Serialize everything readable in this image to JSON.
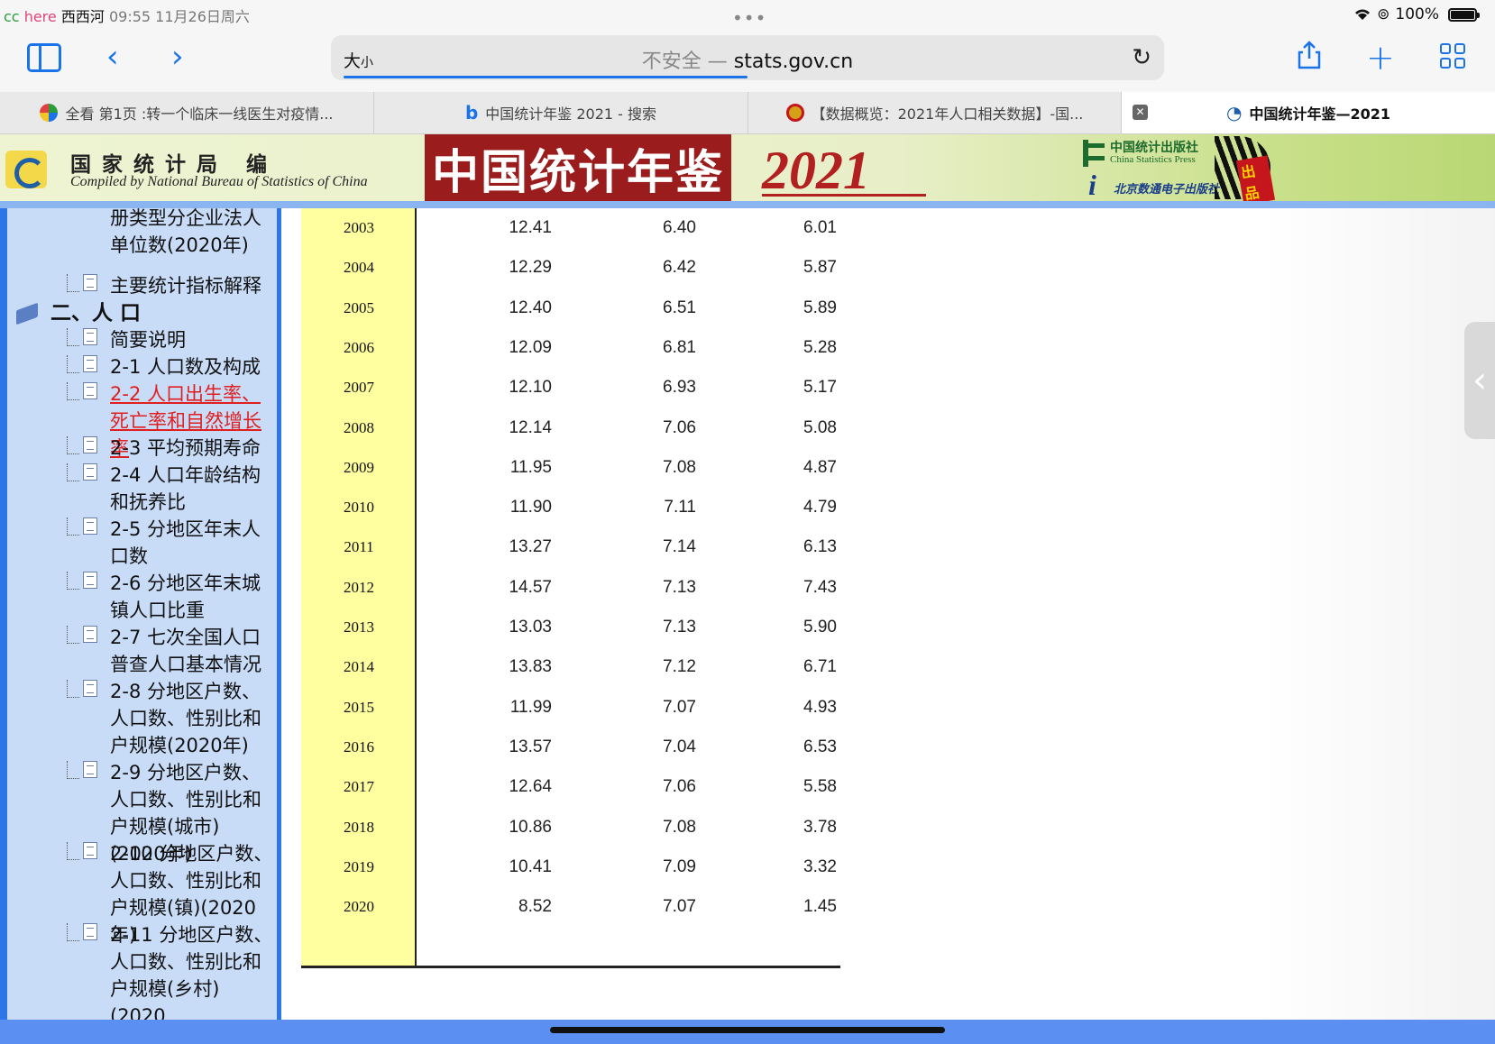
{
  "status": {
    "overlay_cc": "cc",
    "overlay_here": "here",
    "overlay_place": "西西河",
    "time_date": "09:55  11月26日周六",
    "battery": "100%"
  },
  "toolbar": {
    "text_size": "大",
    "text_size_small": "小",
    "insecure": "不安全 —",
    "domain": "stats.gov.cn",
    "load_progress": 0.5
  },
  "tabs": [
    {
      "title": "全看 第1页 :转一个临床一线医生对疫情...",
      "active": false
    },
    {
      "title": "中国统计年鉴 2021 - 搜索",
      "active": false
    },
    {
      "title": "【数据概览：2021年人口相关数据】-国...",
      "active": false
    },
    {
      "title": "中国统计年鉴—2021",
      "active": true
    }
  ],
  "banner": {
    "bureau": "国家统计局  编",
    "compiled": "Compiled by National Bureau of Statistics of China",
    "title": "中国统计年鉴",
    "year": "2021",
    "publisher_cn": "中国统计出版社",
    "publisher_en": "China Statistics Press",
    "publisher2": "北京数通电子出版社",
    "badge": "出品"
  },
  "nav": {
    "items_before": [
      {
        "text": "册类型分企业法人单位数(2020年)",
        "active": false,
        "icon": false
      },
      {
        "text": "主要统计指标解释",
        "active": false,
        "icon": true
      }
    ],
    "section": "二、人  口",
    "items": [
      {
        "text": "简要说明",
        "active": false
      },
      {
        "text": "2-1 人口数及构成",
        "active": false
      },
      {
        "text": "2-2 人口出生率、死亡率和自然增长率",
        "active": true
      },
      {
        "text": "2-3 平均预期寿命",
        "active": false
      },
      {
        "text": "2-4 人口年龄结构和抚养比",
        "active": false
      },
      {
        "text": "2-5 分地区年末人口数",
        "active": false
      },
      {
        "text": "2-6 分地区年末城镇人口比重",
        "active": false
      },
      {
        "text": "2-7 七次全国人口普查人口基本情况",
        "active": false
      },
      {
        "text": "2-8 分地区户数、人口数、性别比和户规模(2020年)",
        "active": false
      },
      {
        "text": "2-9 分地区户数、人口数、性别比和户规模(城市)(2020年)",
        "active": false
      },
      {
        "text": "2-10 分地区户数、人口数、性别比和户规模(镇)(2020年)",
        "active": false
      },
      {
        "text": "2-11 分地区户数、人口数、性别比和户规模(乡村)(2020",
        "active": false
      }
    ]
  },
  "table": {
    "rows": [
      {
        "year": "2003",
        "birth": "12.41",
        "death": "6.40",
        "growth": "6.01"
      },
      {
        "year": "2004",
        "birth": "12.29",
        "death": "6.42",
        "growth": "5.87"
      },
      {
        "year": "2005",
        "birth": "12.40",
        "death": "6.51",
        "growth": "5.89"
      },
      {
        "year": "2006",
        "birth": "12.09",
        "death": "6.81",
        "growth": "5.28"
      },
      {
        "year": "2007",
        "birth": "12.10",
        "death": "6.93",
        "growth": "5.17"
      },
      {
        "year": "2008",
        "birth": "12.14",
        "death": "7.06",
        "growth": "5.08"
      },
      {
        "year": "2009",
        "birth": "11.95",
        "death": "7.08",
        "growth": "4.87"
      },
      {
        "year": "2010",
        "birth": "11.90",
        "death": "7.11",
        "growth": "4.79"
      },
      {
        "year": "2011",
        "birth": "13.27",
        "death": "7.14",
        "growth": "6.13"
      },
      {
        "year": "2012",
        "birth": "14.57",
        "death": "7.13",
        "growth": "7.43"
      },
      {
        "year": "2013",
        "birth": "13.03",
        "death": "7.13",
        "growth": "5.90"
      },
      {
        "year": "2014",
        "birth": "13.83",
        "death": "7.12",
        "growth": "6.71"
      },
      {
        "year": "2015",
        "birth": "11.99",
        "death": "7.07",
        "growth": "4.93"
      },
      {
        "year": "2016",
        "birth": "13.57",
        "death": "7.04",
        "growth": "6.53"
      },
      {
        "year": "2017",
        "birth": "12.64",
        "death": "7.06",
        "growth": "5.58"
      },
      {
        "year": "2018",
        "birth": "10.86",
        "death": "7.08",
        "growth": "3.78"
      },
      {
        "year": "2019",
        "birth": "10.41",
        "death": "7.09",
        "growth": "3.32"
      },
      {
        "year": "2020",
        "birth": "8.52",
        "death": "7.07",
        "growth": "1.45"
      }
    ]
  },
  "colors": {
    "accent": "#1a73e8",
    "nav_bg": "#c8dcf8",
    "nav_border": "#2e75e6",
    "year_col": "#ffffa0",
    "active_link": "#e02020",
    "banner_red": "#9b1c1c"
  },
  "icons": {
    "sidebar_toggle": "sidebar-icon",
    "back": "chevron-left-icon",
    "forward": "chevron-right-icon",
    "reload": "reload-icon",
    "share": "share-icon",
    "new_tab": "plus-icon",
    "tab_overview": "tabs-grid-icon"
  }
}
